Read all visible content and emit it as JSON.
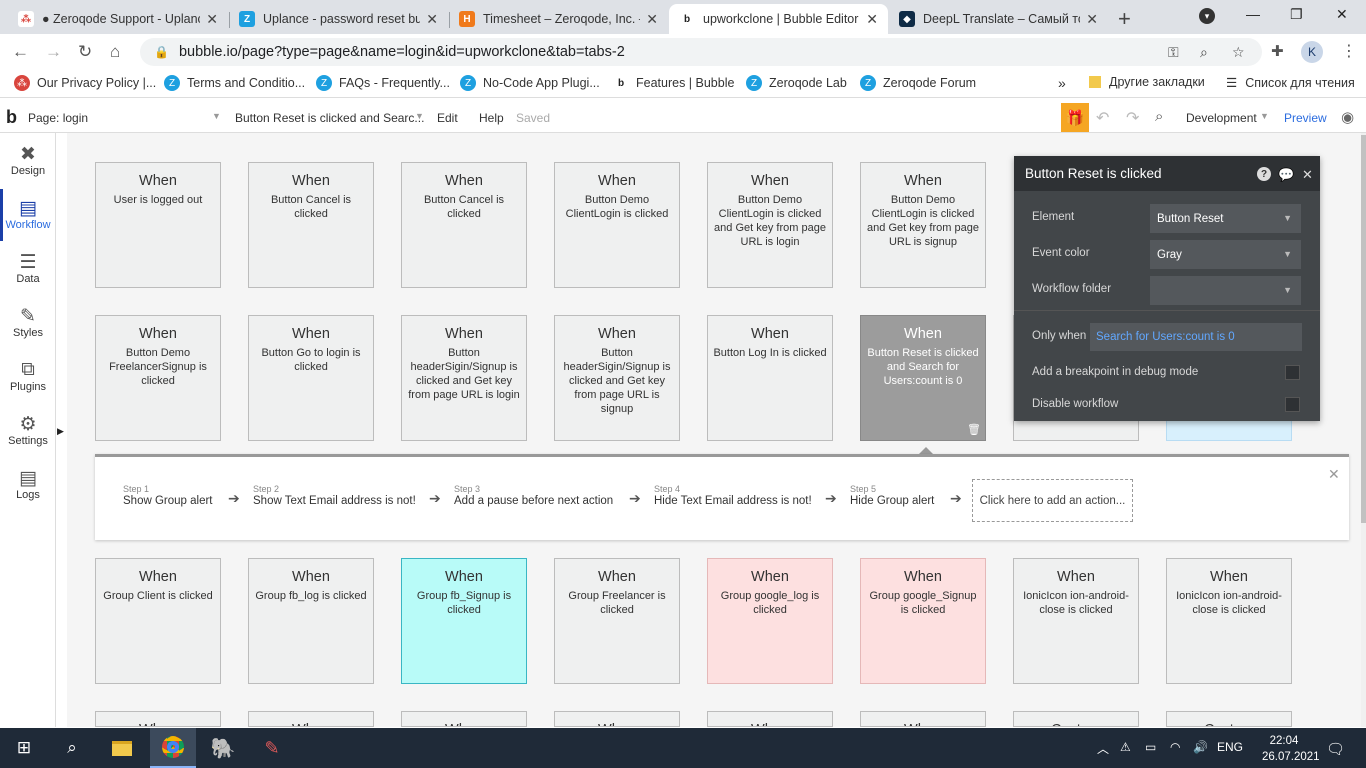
{
  "browser": {
    "tabs": [
      {
        "title": "● Zeroqode Support - Uplanc",
        "fav_bg": "#fff",
        "fav_color": "#d9453d",
        "fav_glyph": "⁂",
        "active": false
      },
      {
        "title": "Uplance - password reset bug",
        "fav_bg": "#1ea0e0",
        "fav_color": "#fff",
        "fav_glyph": "Z",
        "active": false
      },
      {
        "title": "Timesheet – Zeroqode, Inc. –",
        "fav_bg": "#f07a1b",
        "fav_color": "#fff",
        "fav_glyph": "H",
        "active": false
      },
      {
        "title": "upworkclone | Bubble Editor",
        "fav_bg": "#fff",
        "fav_color": "#222",
        "fav_glyph": "b",
        "active": true
      },
      {
        "title": "DeepL Translate – Самый точ",
        "fav_bg": "#0f2b46",
        "fav_color": "#fff",
        "fav_glyph": "◆",
        "active": false
      }
    ],
    "url": "bubble.io/page?type=page&name=login&id=upworkclone&tab=tabs-2",
    "profile_initial": "K",
    "bookmarks": [
      {
        "label": "Our Privacy Policy |...",
        "bg": "#d9453d",
        "glyph": "⁂"
      },
      {
        "label": "Terms and Conditio...",
        "bg": "#1ea0e0",
        "glyph": "Z"
      },
      {
        "label": "FAQs - Frequently...",
        "bg": "#1ea0e0",
        "glyph": "Z"
      },
      {
        "label": "No-Code App Plugi...",
        "bg": "#1ea0e0",
        "glyph": "Z"
      },
      {
        "label": "Features | Bubble",
        "bg": "#fff",
        "glyph": "b"
      },
      {
        "label": "Zeroqode Lab",
        "bg": "#1ea0e0",
        "glyph": "Z"
      },
      {
        "label": "Zeroqode Forum",
        "bg": "#1ea0e0",
        "glyph": "Z"
      }
    ],
    "other_bookmarks": "Другие закладки",
    "reading_list": "Список для чтения"
  },
  "editor": {
    "page_label": "Page: login",
    "event_selector": "Button Reset is clicked and Searc...",
    "menu_edit": "Edit",
    "menu_help": "Help",
    "saved": "Saved",
    "env": "Development",
    "preview": "Preview"
  },
  "sidebar": [
    {
      "label": "Design",
      "icon": "✖"
    },
    {
      "label": "Workflow",
      "icon": "▤"
    },
    {
      "label": "Data",
      "icon": "☰"
    },
    {
      "label": "Styles",
      "icon": "✎"
    },
    {
      "label": "Plugins",
      "icon": "⧉"
    },
    {
      "label": "Settings",
      "icon": "⚙"
    },
    {
      "label": "Logs",
      "icon": "▤"
    }
  ],
  "events": [
    {
      "when": "When",
      "desc": "User is logged out",
      "style": ""
    },
    {
      "when": "When",
      "desc": "Button Cancel is clicked",
      "style": ""
    },
    {
      "when": "When",
      "desc": "Button Cancel is clicked",
      "style": ""
    },
    {
      "when": "When",
      "desc": "Button Demo ClientLogin is clicked",
      "style": ""
    },
    {
      "when": "When",
      "desc": "Button Demo ClientLogin is clicked and Get key from page URL is login",
      "style": ""
    },
    {
      "when": "When",
      "desc": "Button Demo ClientLogin is clicked and Get key from page URL is signup",
      "style": ""
    },
    {
      "when": "When",
      "desc": "Button Demo FreelancerSignup is clicked",
      "style": ""
    },
    {
      "when": "When",
      "desc": "Button Go to login is clicked",
      "style": ""
    },
    {
      "when": "When",
      "desc": "Button headerSigin/Signup is clicked and Get key from page URL is login",
      "style": ""
    },
    {
      "when": "When",
      "desc": "Button headerSigin/Signup is clicked and Get key from page URL is signup",
      "style": ""
    },
    {
      "when": "When",
      "desc": "Button Log In is clicked",
      "style": ""
    },
    {
      "when": "When",
      "desc": "Button Reset is clicked and Search for Users:count is 0",
      "style": "sel"
    },
    {
      "when": "When",
      "desc": "Group Client is clicked",
      "style": ""
    },
    {
      "when": "When",
      "desc": "Group fb_log is clicked",
      "style": ""
    },
    {
      "when": "When",
      "desc": "Group fb_Signup is clicked",
      "style": "cyan"
    },
    {
      "when": "When",
      "desc": "Group Freelancer is clicked",
      "style": ""
    },
    {
      "when": "When",
      "desc": "Group google_log is clicked",
      "style": "pink"
    },
    {
      "when": "When",
      "desc": "Group google_Signup is clicked",
      "style": "pink"
    },
    {
      "when": "When",
      "desc": "IonicIcon ion-android-close is clicked",
      "style": ""
    },
    {
      "when": "When",
      "desc": "IonicIcon ion-android-close is clicked",
      "style": ""
    }
  ],
  "bottom_row": [
    "When",
    "When",
    "When",
    "When",
    "When",
    "When",
    "Custom",
    "Custom"
  ],
  "steps": [
    {
      "num": "Step 1",
      "label": "Show Group alert"
    },
    {
      "num": "Step 2",
      "label": "Show Text Email address is not!"
    },
    {
      "num": "Step 3",
      "label": "Add a pause before next action"
    },
    {
      "num": "Step 4",
      "label": "Hide Text Email address is not!"
    },
    {
      "num": "Step 5",
      "label": "Hide Group alert"
    }
  ],
  "add_action": "Click here to add an action...",
  "panel": {
    "title": "Button Reset is clicked",
    "element_label": "Element",
    "element_value": "Button Reset",
    "color_label": "Event color",
    "color_value": "Gray",
    "folder_label": "Workflow folder",
    "folder_value": "",
    "only_when_label": "Only when",
    "only_when_value": "Search for Users:count is 0",
    "breakpoint_label": "Add a breakpoint in debug mode",
    "disable_label": "Disable workflow"
  },
  "taskbar": {
    "lang": "ENG",
    "time": "22:04",
    "date": "26.07.2021"
  }
}
